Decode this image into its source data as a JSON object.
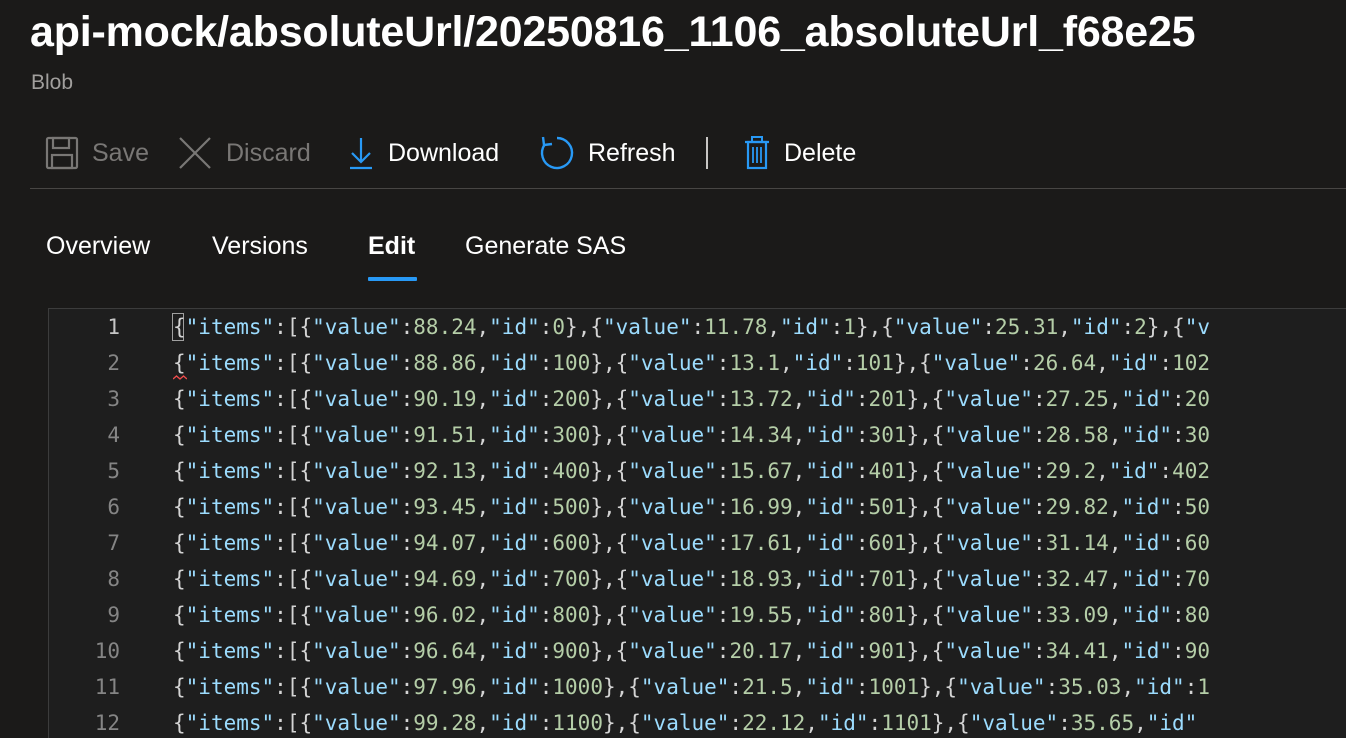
{
  "header": {
    "title": "api-mock/absoluteUrl/20250816_1106_absoluteUrl_f68e25",
    "subtitle": "Blob"
  },
  "toolbar": {
    "save_label": "Save",
    "discard_label": "Discard",
    "download_label": "Download",
    "refresh_label": "Refresh",
    "delete_label": "Delete"
  },
  "tabs": [
    {
      "label": "Overview"
    },
    {
      "label": "Versions"
    },
    {
      "label": "Edit"
    },
    {
      "label": "Generate SAS"
    }
  ],
  "editor": {
    "lines": [
      {
        "num": "1",
        "text": "{\"items\":[{\"value\":88.24,\"id\":0},{\"value\":11.78,\"id\":1},{\"value\":25.31,\"id\":2},{\"v"
      },
      {
        "num": "2",
        "text": "{\"items\":[{\"value\":88.86,\"id\":100},{\"value\":13.1,\"id\":101},{\"value\":26.64,\"id\":102"
      },
      {
        "num": "3",
        "text": "{\"items\":[{\"value\":90.19,\"id\":200},{\"value\":13.72,\"id\":201},{\"value\":27.25,\"id\":20"
      },
      {
        "num": "4",
        "text": "{\"items\":[{\"value\":91.51,\"id\":300},{\"value\":14.34,\"id\":301},{\"value\":28.58,\"id\":30"
      },
      {
        "num": "5",
        "text": "{\"items\":[{\"value\":92.13,\"id\":400},{\"value\":15.67,\"id\":401},{\"value\":29.2,\"id\":402"
      },
      {
        "num": "6",
        "text": "{\"items\":[{\"value\":93.45,\"id\":500},{\"value\":16.99,\"id\":501},{\"value\":29.82,\"id\":50"
      },
      {
        "num": "7",
        "text": "{\"items\":[{\"value\":94.07,\"id\":600},{\"value\":17.61,\"id\":601},{\"value\":31.14,\"id\":60"
      },
      {
        "num": "8",
        "text": "{\"items\":[{\"value\":94.69,\"id\":700},{\"value\":18.93,\"id\":701},{\"value\":32.47,\"id\":70"
      },
      {
        "num": "9",
        "text": "{\"items\":[{\"value\":96.02,\"id\":800},{\"value\":19.55,\"id\":801},{\"value\":33.09,\"id\":80"
      },
      {
        "num": "10",
        "text": "{\"items\":[{\"value\":96.64,\"id\":900},{\"value\":20.17,\"id\":901},{\"value\":34.41,\"id\":90"
      },
      {
        "num": "11",
        "text": "{\"items\":[{\"value\":97.96,\"id\":1000},{\"value\":21.5,\"id\":1001},{\"value\":35.03,\"id\":1"
      },
      {
        "num": "12",
        "text": "{\"items\":[{\"value\":99.28,\"id\":1100},{\"value\":22.12,\"id\":1101},{\"value\":35.65,\"id\""
      }
    ]
  },
  "colors": {
    "background": "#1b1a19",
    "accent": "#2899f5",
    "json_key": "#9cdcfe",
    "json_number": "#b5cea8",
    "disabled": "#797775"
  },
  "icons": {
    "save": "save-icon",
    "discard": "close-icon",
    "download": "download-icon",
    "refresh": "refresh-icon",
    "delete": "trash-icon"
  }
}
